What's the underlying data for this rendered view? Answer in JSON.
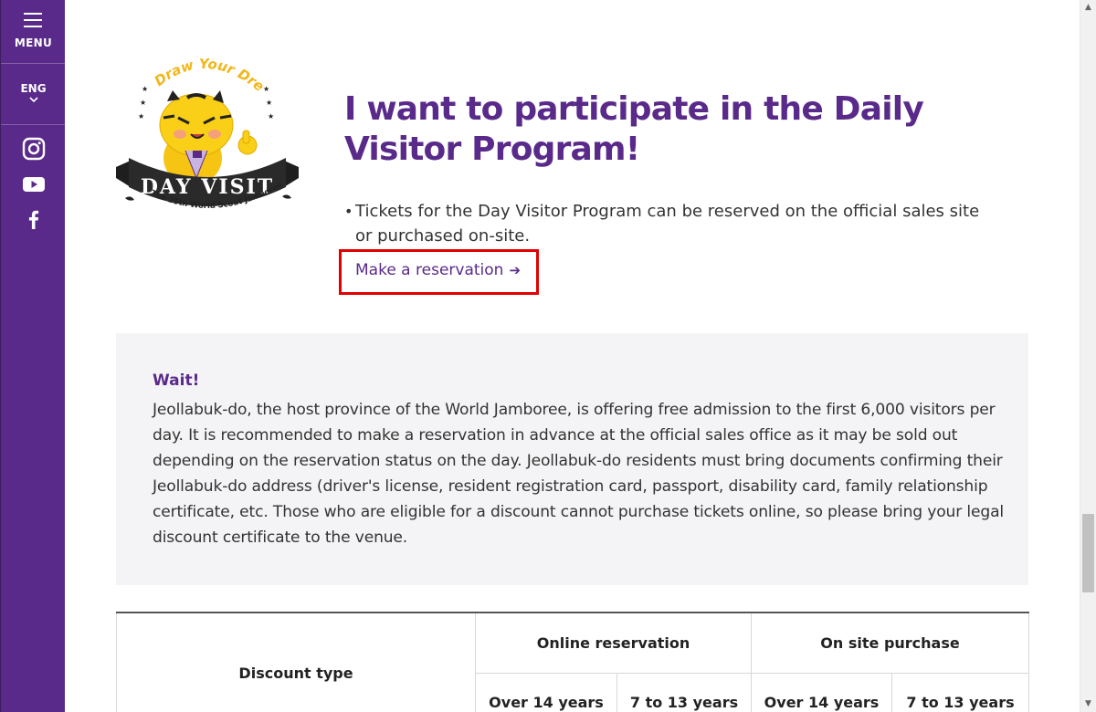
{
  "sidebar": {
    "menu_label": "MENU",
    "lang_label": "ENG",
    "social": [
      "instagram-icon",
      "youtube-icon",
      "facebook-icon"
    ]
  },
  "logo": {
    "arc_text": "Draw Your Dream",
    "banner_text": "DAY VISIT",
    "bottom_text": "The 25th World Scout Jamboree"
  },
  "main": {
    "title": "I want to participate in the Daily Visitor Program!",
    "bullet": "Tickets for the Day Visitor Program can be reserved on the official sales site or purchased on-site.",
    "reserve_link": "Make a reservation"
  },
  "notice": {
    "title": "Wait!",
    "body": "Jeollabuk-do, the host province of the World Jamboree, is offering free admission to the first 6,000 visitors per day. It is recommended to make a reservation in advance at the official sales office as it may be sold out depending on the reservation status on the day. Jeollabuk-do residents must bring documents confirming their Jeollabuk-do address (driver's license, resident registration card, passport, disability card, family relationship certificate, etc. Those who are eligible for a discount cannot purchase tickets online, so please bring your legal discount certificate to the venue."
  },
  "table": {
    "discount_type": "Discount type",
    "groups": [
      "Online reservation",
      "On site purchase"
    ],
    "subheaders": [
      "Over 14 years",
      "7 to 13 years",
      "Over 14 years",
      "7 to 13 years"
    ]
  },
  "colors": {
    "brand_purple": "#5a2a8a",
    "highlight_red": "#e00000",
    "notice_bg": "#f4f4f6"
  }
}
